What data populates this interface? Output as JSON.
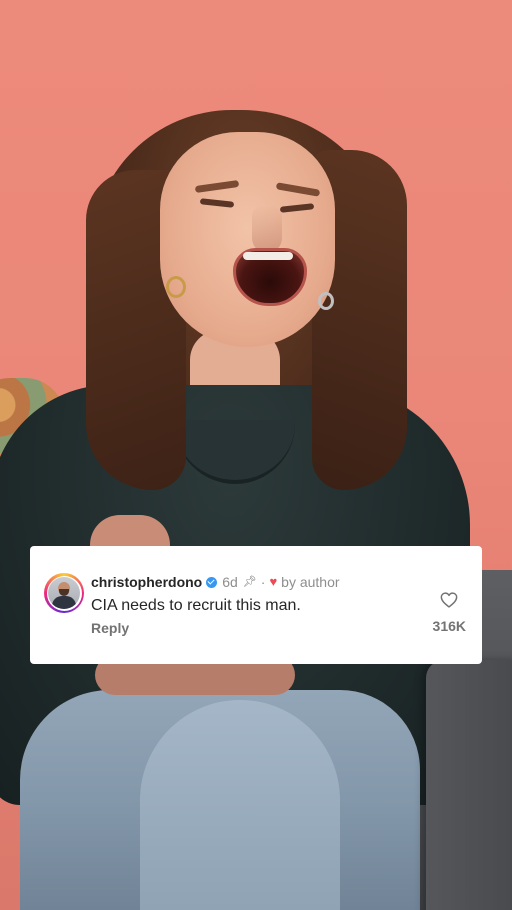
{
  "comment": {
    "username": "christopherdono",
    "verified_icon": "verified-badge-icon",
    "age": "6d",
    "pin_icon": "pin-icon",
    "separator": "·",
    "liked_by_icon": "heart-icon",
    "liked_by_label": "by author",
    "text": "CIA needs to recruit this man.",
    "reply_label": "Reply",
    "like_icon": "heart-outline-icon",
    "like_count": "316K"
  },
  "colors": {
    "background": "#ea8779",
    "card": "#ffffff",
    "username": "#262626",
    "secondary_text": "#8e8e8e",
    "verified": "#3897f0",
    "author_heart": "#ed4956"
  }
}
